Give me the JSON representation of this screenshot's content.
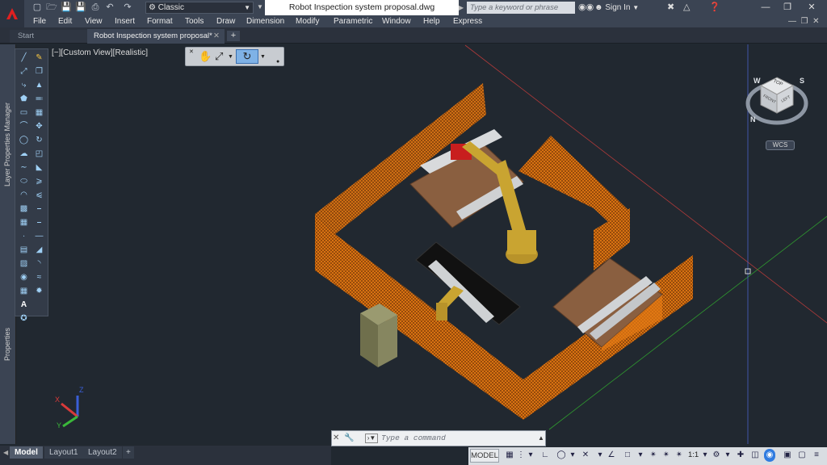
{
  "titlebar": {
    "workspace": "Classic",
    "document_title": "Robot Inspection system proposal.dwg",
    "search_placeholder": "Type a keyword or phrase",
    "sign_in": "Sign In"
  },
  "menu": [
    "File",
    "Edit",
    "View",
    "Insert",
    "Format",
    "Tools",
    "Draw",
    "Dimension",
    "Modify",
    "Parametric",
    "Window",
    "Help",
    "Express"
  ],
  "tabs": {
    "start": "Start",
    "document": "Robot Inspection system proposal*"
  },
  "palettes": {
    "layer_properties": "Layer Properties Manager",
    "properties": "Properties"
  },
  "viewport": {
    "label": "[−][Custom View][Realistic]"
  },
  "viewcube": {
    "top": "TOP",
    "front": "FRONT",
    "left": "LEFT",
    "wcs": "WCS",
    "compass_n": "N",
    "compass_s": "S",
    "compass_w": "W"
  },
  "ucs": {
    "x": "X",
    "y": "Y",
    "z": "Z"
  },
  "layout_tabs": [
    "Model",
    "Layout1",
    "Layout2"
  ],
  "command": {
    "placeholder": "Type a command"
  },
  "status": {
    "model": "MODEL",
    "scale": "1:1"
  },
  "colors": {
    "fence": "#f08a1e",
    "robot": "#c7a233",
    "table": "#8a5f40",
    "background": "#212830"
  }
}
